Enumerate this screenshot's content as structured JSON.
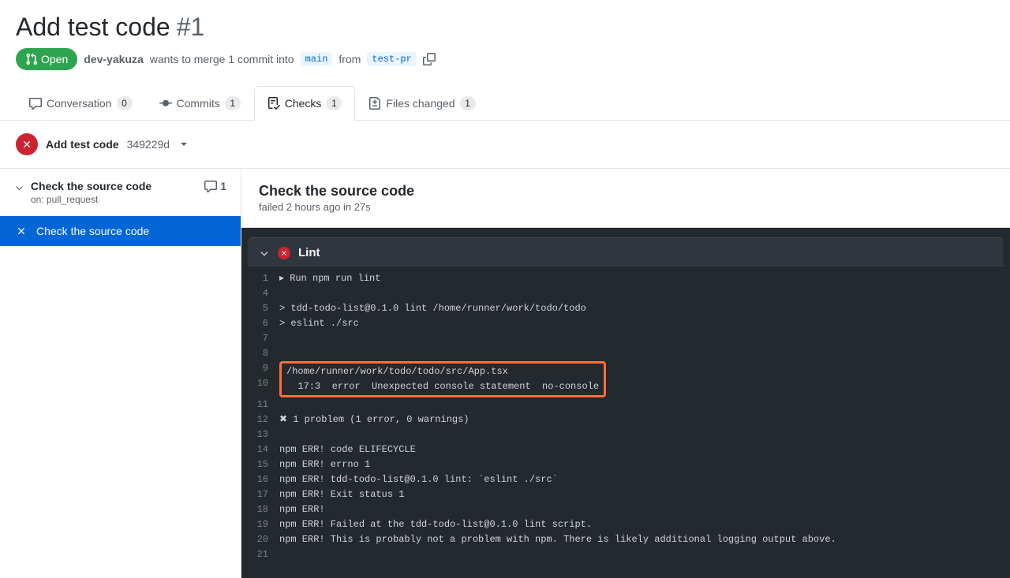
{
  "title": "Add test code",
  "pr_number": "#1",
  "status": "Open",
  "author": "dev-yakuza",
  "merge_text": "wants to merge 1 commit into",
  "base_branch": "main",
  "from_text": "from",
  "head_branch": "test-pr",
  "tabs": {
    "conversation": {
      "label": "Conversation",
      "count": "0"
    },
    "commits": {
      "label": "Commits",
      "count": "1"
    },
    "checks": {
      "label": "Checks",
      "count": "1"
    },
    "files": {
      "label": "Files changed",
      "count": "1"
    }
  },
  "commit": {
    "title": "Add test code",
    "sha": "349229d"
  },
  "sidebar": {
    "workflow_name": "Check the source code",
    "workflow_trigger": "on: pull_request",
    "workflow_annotations": "1",
    "job_name": "Check the source code"
  },
  "run": {
    "title": "Check the source code",
    "subtitle": "failed 2 hours ago in 27s",
    "step_name": "Lint",
    "lines": [
      {
        "n": "1",
        "t": "▸ Run npm run lint"
      },
      {
        "n": "4",
        "t": ""
      },
      {
        "n": "5",
        "t": "> tdd-todo-list@0.1.0 lint /home/runner/work/todo/todo"
      },
      {
        "n": "6",
        "t": "> eslint ./src"
      },
      {
        "n": "7",
        "t": ""
      },
      {
        "n": "8",
        "t": ""
      },
      {
        "n": "9",
        "t": "/home/runner/work/todo/todo/src/App.tsx",
        "hl": true
      },
      {
        "n": "10",
        "t": "  17:3  error  Unexpected console statement  no-console",
        "hl": true
      },
      {
        "n": "11",
        "t": ""
      },
      {
        "n": "12",
        "t": "✖ 1 problem (1 error, 0 warnings)"
      },
      {
        "n": "13",
        "t": ""
      },
      {
        "n": "14",
        "t": "npm ERR! code ELIFECYCLE"
      },
      {
        "n": "15",
        "t": "npm ERR! errno 1"
      },
      {
        "n": "16",
        "t": "npm ERR! tdd-todo-list@0.1.0 lint: `eslint ./src`"
      },
      {
        "n": "17",
        "t": "npm ERR! Exit status 1"
      },
      {
        "n": "18",
        "t": "npm ERR!"
      },
      {
        "n": "19",
        "t": "npm ERR! Failed at the tdd-todo-list@0.1.0 lint script."
      },
      {
        "n": "20",
        "t": "npm ERR! This is probably not a problem with npm. There is likely additional logging output above."
      },
      {
        "n": "21",
        "t": ""
      }
    ]
  }
}
